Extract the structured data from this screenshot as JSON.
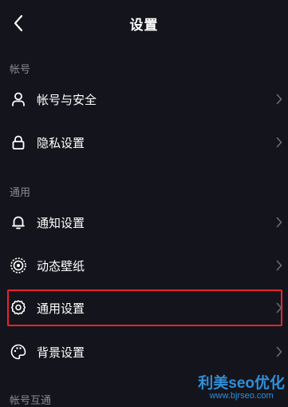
{
  "header": {
    "title": "设置",
    "back_icon": "chevron-left-icon"
  },
  "sections": [
    {
      "label": "帐号",
      "items": [
        {
          "label": "帐号与安全",
          "icon": "user-icon"
        },
        {
          "label": "隐私设置",
          "icon": "lock-icon"
        }
      ]
    },
    {
      "label": "通用",
      "items": [
        {
          "label": "通知设置",
          "icon": "bell-icon"
        },
        {
          "label": "动态壁纸",
          "icon": "wallpaper-icon"
        },
        {
          "label": "通用设置",
          "icon": "gear-icon",
          "highlighted": true
        },
        {
          "label": "背景设置",
          "icon": "palette-icon"
        }
      ]
    },
    {
      "label": "帐号互通",
      "items": []
    }
  ],
  "watermark": {
    "main": "利美seo优化",
    "url": "www.bjrseo.com"
  },
  "colors": {
    "background": "#14141c",
    "text": "#ffffff",
    "section_label": "#8a8a93",
    "chevron": "#6b6b75",
    "highlight": "#e8232d",
    "watermark": "#2f8fd8"
  }
}
